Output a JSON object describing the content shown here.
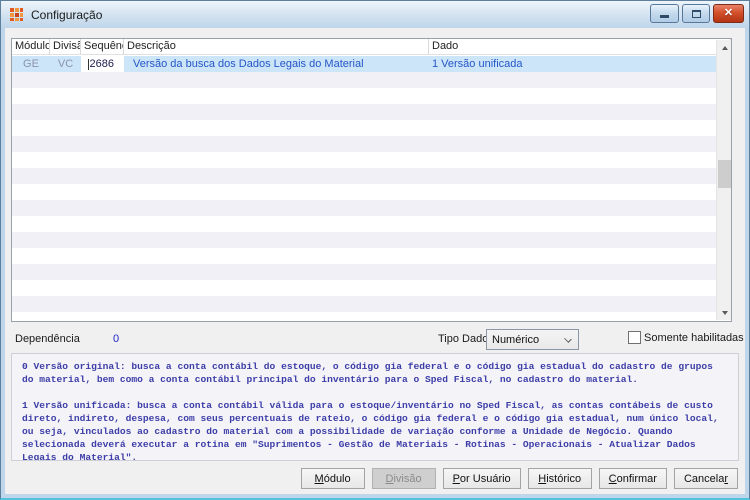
{
  "window": {
    "title": "Configuração",
    "controls": {
      "close_glyph": "✕"
    }
  },
  "colors": {
    "titlebar_blue": "#bfd6ea",
    "selection_bg": "#cde5f8",
    "row_link_blue": "#2456c8",
    "note_navy": "#3d3da8",
    "close_red": "#d4502c",
    "stripe_gray": "#f0f0f6"
  },
  "grid": {
    "columns": [
      "Módulo",
      "Divisão",
      "Sequência",
      "Descrição",
      "Dado"
    ],
    "selected_row": {
      "modulo": "GE",
      "divisao": "VC",
      "sequencia": "2686",
      "descricao": "Versão da busca dos Dados Legais do Material",
      "dado": "1 Versão unificada"
    }
  },
  "details": {
    "dependencia_label": "Dependência",
    "dependencia_value": "0",
    "tipo_dado_label": "Tipo Dado",
    "tipo_dado_value": "Numérico",
    "somente_habilitadas_label": "Somente habilitadas"
  },
  "description": {
    "paragraph_0": "0 Versão original: busca a conta contábil do estoque, o código gia federal e o código gia estadual do cadastro de grupos do material, bem como a conta contábil principal do inventário para o Sped Fiscal, no cadastro do material.",
    "paragraph_1": "1 Versão unificada: busca a conta contábil válida para o estoque/inventário no Sped Fiscal, as contas contábeis de custo direto, indireto, despesa, com seus percentuais de rateio, o código gia federal e o código gia estadual, num único local, ou seja, vinculados ao cadastro do material com a possibilidade de variação conforme a Unidade de Negócio. Quando selecionada deverá executar a rotina em \"Suprimentos - Gestão de Materiais - Rotinas - Operacionais - Atualizar Dados Legais do Material\"."
  },
  "buttons": {
    "modulo": {
      "pre": "",
      "key": "M",
      "rest": "ódulo"
    },
    "divisao": {
      "pre": "",
      "key": "D",
      "rest": "ivisão"
    },
    "por_usuario": {
      "pre": "",
      "key": "P",
      "rest": "or Usuário"
    },
    "historico": {
      "pre": "",
      "key": "H",
      "rest": "istórico"
    },
    "confirmar": {
      "pre": "",
      "key": "C",
      "rest": "onfirmar"
    },
    "cancelar": {
      "pre": "Cancela",
      "key": "r",
      "rest": ""
    }
  }
}
